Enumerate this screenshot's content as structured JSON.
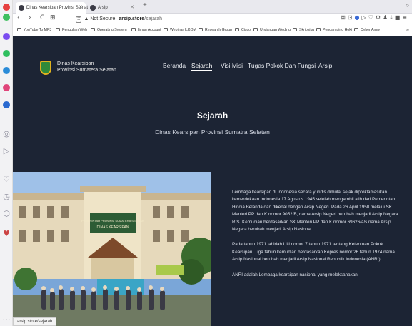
{
  "browser": {
    "tabs": [
      {
        "label": "Dinas Kearsipan Provinsi Sumat"
      },
      {
        "label": "Arsip"
      }
    ],
    "new_tab": "+",
    "tabs_menu": "○",
    "nav": {
      "back": "‹",
      "forward": "›",
      "reload": "C",
      "grid": "⊞"
    },
    "address": {
      "badge": "☷",
      "security": "▲ Not Secure",
      "host": "arsip.store",
      "path": "/sejarah"
    },
    "toolbar_icons": [
      "⊠",
      "⊡",
      "●",
      "▷",
      "♡",
      "⚙",
      "♟",
      "⤓",
      "■",
      "≡"
    ],
    "bookmarks": [
      "YouTube To MP3",
      "Pengulian Web",
      "Operating System",
      "Iiman Account",
      "Webinar ILKOM",
      "Research Group",
      "Cisco",
      "Undangan Weding",
      "Skripsiku",
      "Pendamping Hoki",
      "Cyber Army"
    ],
    "bookmarks_more": "»",
    "status_url": "arsip.store/sejarah"
  },
  "sidebar_icons": [
    {
      "name": "red-dot",
      "color": "#e64040"
    },
    {
      "name": "green-dot",
      "color": "#3fbf5f"
    },
    {
      "name": "messenger-icon",
      "color": "#7a4cf0"
    },
    {
      "name": "whatsapp-icon",
      "color": "#2fbf5f"
    },
    {
      "name": "telegram-icon",
      "color": "#2a8bd8"
    },
    {
      "name": "instagram-icon",
      "color": "#e0447a"
    },
    {
      "name": "vk-icon",
      "color": "#2b6ad0"
    }
  ],
  "site": {
    "brand_line1": "Dinas Kearsipan",
    "brand_line2": "Provinsi Sumatera Selatan",
    "nav": [
      "Beranda",
      "Sejarah",
      "Visi Misi",
      "Tugas Pokok Dan Fungsi",
      "Arsip"
    ],
    "active_nav": "Sejarah",
    "title": "Sejarah",
    "subtitle": "Dinas Kearsipan Provinsi Sumatra Selatan",
    "photo_sign": "DINAS KEARSIPAN",
    "paragraphs": [
      "Lembaga kearsipan di Indonesia secara yuridis dimulai sejak diproklamasikan kemerdekaan Indonesia 17 Agustus 1945 setelah mengambil alih dari Pemerintah Hindia Belanda dan dikenal dengan Arsip Negeri. Pada 26 April 1950 melalui SK Menteri PP dan K nomor 9052/B, nama Arsip Negeri berubah menjadi Arsip Negara RIS. Kemudian berdasarkan SK Menteri PP dan K nomor 69626/a/s nama Arsip Negara berubah menjadi Arsip Nasional.",
      "Pada tahun 1971 lahirlah UU nomor 7 tahun 1971 tentang Ketentuan Pokok Kearsipan. Tiga tahun kemudian berdasarkan Kepres nomor 26 tahun 1974 nama Arsip Nasional berubah menjadi Arsip Nasional Republik Indonesia (ANRI).",
      "ANRI adalah Lembaga kearsipan nasional yang melaksanakan"
    ]
  }
}
